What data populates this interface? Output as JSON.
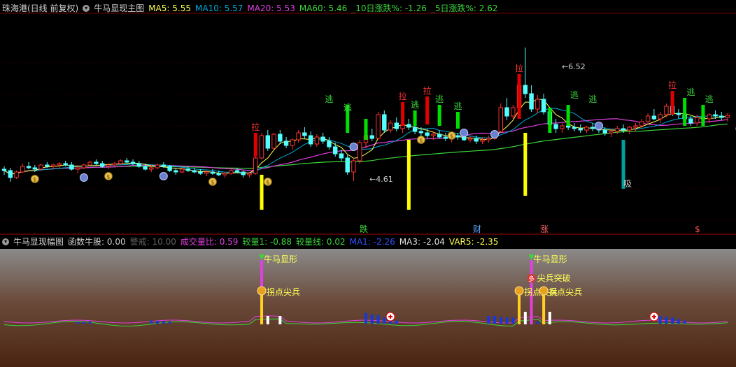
{
  "main_header": {
    "stock": "珠海港(日线 前复权)",
    "indicator": "牛马显现主图",
    "ma5_label": "MA5:",
    "ma5": "5.55",
    "ma10_label": "MA10:",
    "ma10": "5.57",
    "ma20_label": "MA20:",
    "ma20": "5.53",
    "ma60_label": "MA60:",
    "ma60": "5.46",
    "r10_label": "_10日涨跌%:",
    "r10": "-1.26",
    "r5_label": "_5日涨跌%:",
    "r5": "2.62"
  },
  "sub_header": {
    "indicator": "牛马显现幅图",
    "count_label": "函数牛股:",
    "count": "0.00",
    "alert_label": "警戒:",
    "alert": "10.00",
    "vr_label": "成交量比:",
    "vr": "0.59",
    "vol1_label": "较量1:",
    "vol1": "-0.88",
    "vline_label": "较量线:",
    "vline": "0.02",
    "ma1_label": "MA1:",
    "ma1": "-2.26",
    "ma3_label": "MA3:",
    "ma3": "-2.04",
    "var5_label": "VAR5:",
    "var5": "-2.35"
  },
  "colors": {
    "up": "#ff3232",
    "down": "#54ffff",
    "ma5": "#ffff54",
    "ma10": "#00a8d8",
    "ma20": "#e040e0",
    "ma60": "#3cd63c",
    "signal_green": "#00e000",
    "signal_red": "#e00000",
    "yellow_bar": "#ffff00",
    "teal_bar": "#00a0a0"
  },
  "chart_data": {
    "type": "candlestick",
    "price_annotations": [
      {
        "text": "6.52",
        "kind": "high"
      },
      {
        "text": "4.61",
        "kind": "low"
      }
    ],
    "signal_labels": {
      "pull": "拉",
      "escape": "逃",
      "absorb": "吸",
      "fall": "跌",
      "wealth": "财",
      "rise": "涨",
      "money": "$"
    },
    "sub_labels": {
      "bull": "牛马显形",
      "turn": "拐点尖兵",
      "breakout": "尖兵突破",
      "more": "多"
    },
    "candles": [
      [
        4.78,
        4.82,
        4.7,
        4.76
      ],
      [
        4.76,
        4.8,
        4.6,
        4.66
      ],
      [
        4.66,
        4.76,
        4.64,
        4.74
      ],
      [
        4.74,
        4.86,
        4.72,
        4.82
      ],
      [
        4.82,
        4.88,
        4.78,
        4.8
      ],
      [
        4.8,
        4.84,
        4.74,
        4.78
      ],
      [
        4.78,
        4.86,
        4.76,
        4.84
      ],
      [
        4.84,
        4.88,
        4.8,
        4.82
      ],
      [
        4.82,
        4.86,
        4.78,
        4.84
      ],
      [
        4.84,
        4.88,
        4.8,
        4.86
      ],
      [
        4.86,
        4.9,
        4.82,
        4.84
      ],
      [
        4.84,
        4.88,
        4.76,
        4.78
      ],
      [
        4.78,
        4.84,
        4.72,
        4.8
      ],
      [
        4.8,
        4.86,
        4.78,
        4.84
      ],
      [
        4.84,
        4.9,
        4.82,
        4.88
      ],
      [
        4.88,
        4.92,
        4.84,
        4.86
      ],
      [
        4.86,
        4.9,
        4.8,
        4.82
      ],
      [
        4.82,
        4.86,
        4.78,
        4.84
      ],
      [
        4.84,
        4.88,
        4.82,
        4.86
      ],
      [
        4.86,
        4.92,
        4.84,
        4.9
      ],
      [
        4.9,
        4.94,
        4.86,
        4.88
      ],
      [
        4.88,
        4.92,
        4.84,
        4.86
      ],
      [
        4.86,
        4.9,
        4.8,
        4.82
      ],
      [
        4.82,
        4.86,
        4.76,
        4.78
      ],
      [
        4.78,
        4.84,
        4.74,
        4.8
      ],
      [
        4.8,
        4.86,
        4.78,
        4.84
      ],
      [
        4.84,
        4.88,
        4.8,
        4.82
      ],
      [
        4.82,
        4.84,
        4.74,
        4.76
      ],
      [
        4.76,
        4.8,
        4.7,
        4.74
      ],
      [
        4.74,
        4.8,
        4.72,
        4.78
      ],
      [
        4.78,
        4.82,
        4.74,
        4.76
      ],
      [
        4.76,
        4.8,
        4.72,
        4.74
      ],
      [
        4.74,
        4.78,
        4.7,
        4.72
      ],
      [
        4.72,
        4.76,
        4.68,
        4.74
      ],
      [
        4.74,
        4.78,
        4.7,
        4.72
      ],
      [
        4.72,
        4.76,
        4.68,
        4.7
      ],
      [
        4.7,
        4.74,
        4.66,
        4.72
      ],
      [
        4.72,
        4.78,
        4.7,
        4.76
      ],
      [
        4.76,
        4.8,
        4.72,
        4.74
      ],
      [
        4.74,
        4.76,
        4.66,
        4.7
      ],
      [
        4.7,
        4.74,
        4.66,
        4.72
      ],
      [
        4.72,
        4.96,
        4.7,
        4.94
      ],
      [
        4.94,
        5.3,
        4.92,
        5.26
      ],
      [
        5.26,
        5.34,
        5.04,
        5.08
      ],
      [
        5.08,
        5.3,
        5.06,
        5.28
      ],
      [
        5.28,
        5.34,
        5.14,
        5.18
      ],
      [
        5.18,
        5.24,
        5.08,
        5.12
      ],
      [
        5.12,
        5.22,
        5.06,
        5.2
      ],
      [
        5.2,
        5.34,
        5.16,
        5.3
      ],
      [
        5.3,
        5.38,
        5.22,
        5.26
      ],
      [
        5.26,
        5.32,
        5.1,
        5.14
      ],
      [
        5.14,
        5.28,
        5.1,
        5.24
      ],
      [
        5.24,
        5.3,
        5.14,
        5.18
      ],
      [
        5.18,
        5.24,
        5.06,
        5.1
      ],
      [
        5.1,
        5.16,
        4.96,
        5.0
      ],
      [
        5.0,
        5.06,
        4.9,
        4.94
      ],
      [
        4.94,
        4.98,
        4.7,
        4.74
      ],
      [
        4.74,
        4.94,
        4.61,
        4.9
      ],
      [
        4.9,
        5.2,
        4.86,
        5.16
      ],
      [
        5.16,
        5.3,
        5.08,
        5.26
      ],
      [
        5.26,
        5.36,
        5.18,
        5.22
      ],
      [
        5.22,
        5.6,
        5.2,
        5.56
      ],
      [
        5.56,
        5.62,
        5.3,
        5.34
      ],
      [
        5.34,
        5.48,
        5.3,
        5.44
      ],
      [
        5.44,
        5.52,
        5.32,
        5.36
      ],
      [
        5.36,
        5.46,
        5.3,
        5.42
      ],
      [
        5.42,
        5.5,
        5.34,
        5.38
      ],
      [
        5.38,
        5.44,
        5.28,
        5.32
      ],
      [
        5.32,
        5.38,
        5.24,
        5.3
      ],
      [
        5.3,
        5.36,
        5.22,
        5.26
      ],
      [
        5.26,
        5.32,
        5.2,
        5.28
      ],
      [
        5.28,
        5.34,
        5.22,
        5.24
      ],
      [
        5.24,
        5.3,
        5.18,
        5.22
      ],
      [
        5.22,
        5.28,
        5.16,
        5.26
      ],
      [
        5.26,
        5.3,
        5.2,
        5.24
      ],
      [
        5.24,
        5.28,
        5.18,
        5.2
      ],
      [
        5.2,
        5.26,
        5.16,
        5.22
      ],
      [
        5.22,
        5.26,
        5.14,
        5.18
      ],
      [
        5.18,
        5.24,
        5.14,
        5.2
      ],
      [
        5.2,
        5.26,
        5.16,
        5.22
      ],
      [
        5.22,
        5.34,
        5.2,
        5.32
      ],
      [
        5.32,
        5.72,
        5.3,
        5.66
      ],
      [
        5.66,
        5.8,
        5.48,
        5.54
      ],
      [
        5.54,
        5.7,
        5.5,
        5.66
      ],
      [
        5.66,
        6.06,
        5.62,
        5.98
      ],
      [
        5.98,
        6.52,
        5.8,
        5.86
      ],
      [
        5.86,
        5.98,
        5.6,
        5.64
      ],
      [
        5.64,
        5.84,
        5.58,
        5.78
      ],
      [
        5.78,
        5.86,
        5.56,
        5.6
      ],
      [
        5.6,
        5.66,
        5.38,
        5.42
      ],
      [
        5.42,
        5.5,
        5.3,
        5.36
      ],
      [
        5.36,
        5.44,
        5.3,
        5.4
      ],
      [
        5.4,
        5.46,
        5.34,
        5.38
      ],
      [
        5.38,
        5.44,
        5.32,
        5.36
      ],
      [
        5.36,
        5.42,
        5.3,
        5.34
      ],
      [
        5.34,
        5.4,
        5.3,
        5.38
      ],
      [
        5.38,
        5.44,
        5.32,
        5.36
      ],
      [
        5.36,
        5.42,
        5.3,
        5.34
      ],
      [
        5.34,
        5.38,
        5.26,
        5.3
      ],
      [
        5.3,
        5.36,
        5.24,
        5.32
      ],
      [
        5.32,
        5.4,
        5.28,
        5.36
      ],
      [
        5.36,
        5.42,
        5.3,
        5.34
      ],
      [
        5.34,
        5.4,
        5.28,
        5.38
      ],
      [
        5.38,
        5.44,
        5.32,
        5.4
      ],
      [
        5.4,
        5.5,
        5.36,
        5.46
      ],
      [
        5.46,
        5.58,
        5.42,
        5.54
      ],
      [
        5.54,
        5.64,
        5.48,
        5.5
      ],
      [
        5.5,
        5.6,
        5.44,
        5.56
      ],
      [
        5.56,
        5.72,
        5.52,
        5.68
      ],
      [
        5.68,
        5.76,
        5.54,
        5.58
      ],
      [
        5.58,
        5.64,
        5.5,
        5.56
      ],
      [
        5.56,
        5.6,
        5.46,
        5.5
      ],
      [
        5.5,
        5.54,
        5.4,
        5.44
      ],
      [
        5.44,
        5.56,
        5.4,
        5.52
      ],
      [
        5.52,
        5.6,
        5.46,
        5.5
      ],
      [
        5.5,
        5.58,
        5.44,
        5.56
      ],
      [
        5.56,
        5.62,
        5.5,
        5.54
      ],
      [
        5.54,
        5.6,
        5.48,
        5.52
      ],
      [
        5.52,
        5.58,
        5.46,
        5.55
      ]
    ],
    "vol_bars_sub": [
      {
        "i": 12,
        "h": 0.12
      },
      {
        "i": 13,
        "h": 0.12
      },
      {
        "i": 14,
        "h": 0.12
      },
      {
        "i": 24,
        "h": 0.2
      },
      {
        "i": 25,
        "h": 0.18
      },
      {
        "i": 26,
        "h": 0.15
      },
      {
        "i": 27,
        "h": 0.12
      },
      {
        "i": 59,
        "h": 0.7
      },
      {
        "i": 60,
        "h": 0.6
      },
      {
        "i": 61,
        "h": 0.55
      },
      {
        "i": 62,
        "h": 0.4
      },
      {
        "i": 63,
        "h": 0.3
      },
      {
        "i": 64,
        "h": 0.2
      },
      {
        "i": 79,
        "h": 0.5
      },
      {
        "i": 80,
        "h": 0.5
      },
      {
        "i": 81,
        "h": 0.45
      },
      {
        "i": 82,
        "h": 0.4
      },
      {
        "i": 83,
        "h": 0.4
      },
      {
        "i": 84,
        "h": 0.35
      },
      {
        "i": 85,
        "h": 0.3
      },
      {
        "i": 86,
        "h": 0.25
      },
      {
        "i": 87,
        "h": 0.15
      },
      {
        "i": 107,
        "h": 0.5
      },
      {
        "i": 108,
        "h": 0.45
      },
      {
        "i": 109,
        "h": 0.4
      },
      {
        "i": 110,
        "h": 0.3
      },
      {
        "i": 111,
        "h": 0.2
      },
      {
        "i": 130,
        "h": 0.15
      },
      {
        "i": 131,
        "h": 0.12
      },
      {
        "i": 132,
        "h": 0.12
      },
      {
        "i": 133,
        "h": 0.1
      },
      {
        "i": 134,
        "h": 0.08
      }
    ]
  }
}
